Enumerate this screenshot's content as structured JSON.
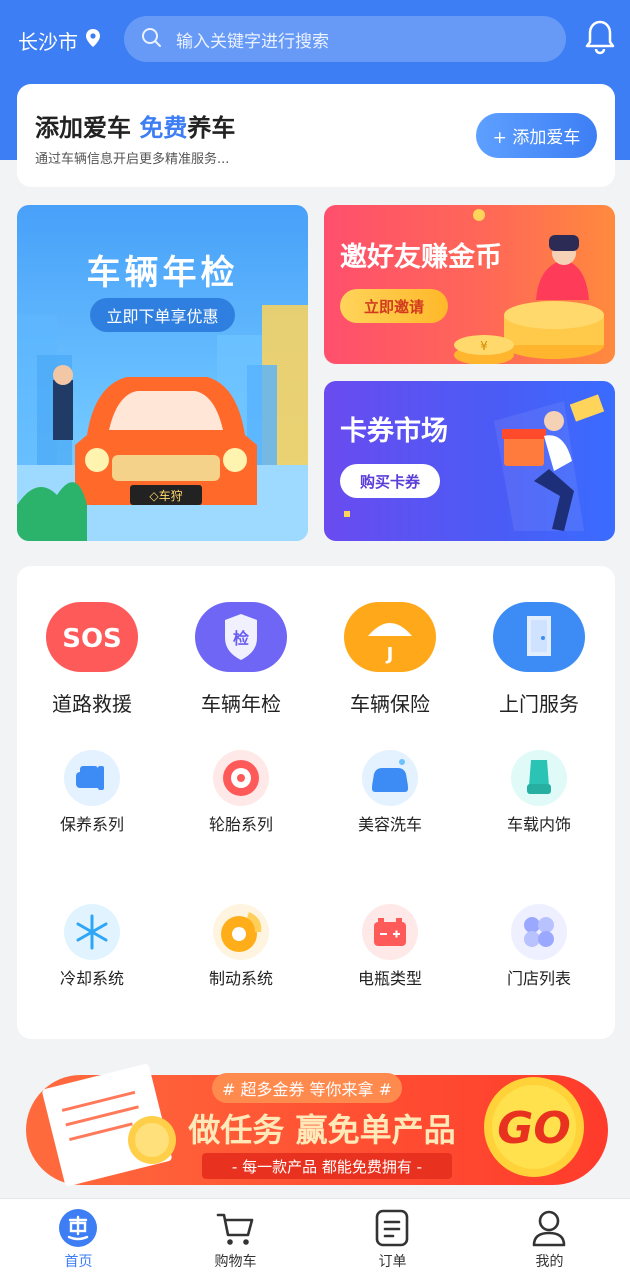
{
  "header": {
    "city": "长沙市",
    "search_placeholder": "输入关键字进行搜索",
    "icons": [
      "location-pin-icon",
      "search-icon",
      "bell-icon"
    ]
  },
  "add_car": {
    "title_main": "添加爱车",
    "title_highlight": "免费",
    "title_tail": "养车",
    "subtitle": "通过车辆信息开启更多精准服务...",
    "button": "+ 添加爱车"
  },
  "promos": {
    "inspection": {
      "title": "车辆年检",
      "pill": "立即下单享优惠",
      "plate": "◇车狩"
    },
    "invite": {
      "title": "邀好友赚金币",
      "pill": "立即邀请",
      "coin": "¥"
    },
    "coupon": {
      "title": "卡券市场",
      "pill": "购买卡券"
    }
  },
  "services_main": [
    {
      "label": "道路救援",
      "icon": "sos-icon",
      "badge": "SOS"
    },
    {
      "label": "车辆年检",
      "icon": "shield-check-icon",
      "badge": "检"
    },
    {
      "label": "车辆保险",
      "icon": "umbrella-icon",
      "badge": "J"
    },
    {
      "label": "上门服务",
      "icon": "door-icon"
    }
  ],
  "services_more": [
    {
      "label": "保养系列",
      "icon": "car-wrench-icon"
    },
    {
      "label": "轮胎系列",
      "icon": "tire-icon"
    },
    {
      "label": "美容洗车",
      "icon": "car-wash-icon"
    },
    {
      "label": "车载内饰",
      "icon": "car-seat-icon"
    },
    {
      "label": "冷却系统",
      "icon": "snowflake-icon"
    },
    {
      "label": "制动系统",
      "icon": "brake-disc-icon"
    },
    {
      "label": "电瓶类型",
      "icon": "battery-icon"
    },
    {
      "label": "门店列表",
      "icon": "grid-four-icon"
    }
  ],
  "task_banner": {
    "top": "# 超多金券 等你来拿 #",
    "main": "做任务 赢免单产品",
    "bottom": "- 每一款产品 都能免费拥有 -",
    "go": "GO"
  },
  "tabs": [
    {
      "label": "首页",
      "icon": "home-hui-icon",
      "active": true
    },
    {
      "label": "购物车",
      "icon": "cart-icon",
      "active": false
    },
    {
      "label": "订单",
      "icon": "order-icon",
      "active": false
    },
    {
      "label": "我的",
      "icon": "user-icon",
      "active": false
    }
  ],
  "colors": {
    "primary": "#3d7ef5",
    "bg": "#f2f3f5"
  }
}
